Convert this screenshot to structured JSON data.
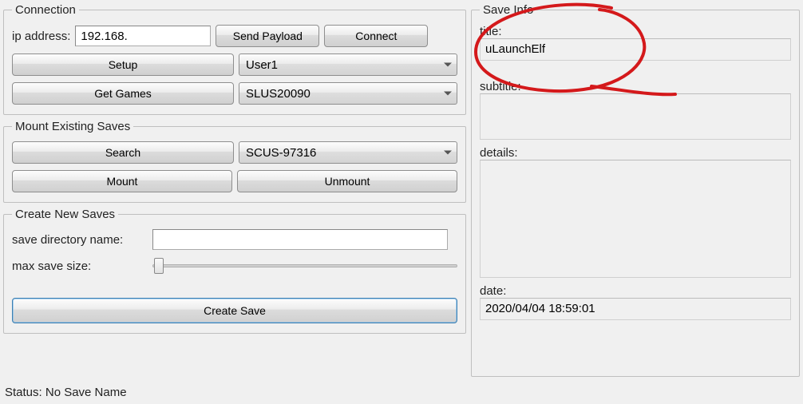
{
  "connection": {
    "legend": "Connection",
    "ip_label": "ip address:",
    "ip_value": "192.168.",
    "send_payload": "Send Payload",
    "connect": "Connect",
    "setup": "Setup",
    "user_combo": "User1",
    "get_games": "Get Games",
    "game_combo": "SLUS20090"
  },
  "mount": {
    "legend": "Mount Existing Saves",
    "search": "Search",
    "save_combo": "SCUS-97316",
    "mount_btn": "Mount",
    "unmount_btn": "Unmount"
  },
  "create": {
    "legend": "Create New Saves",
    "dir_label": "save directory name:",
    "dir_value": "",
    "size_label": "max save size:",
    "create_btn": "Create Save"
  },
  "save_info": {
    "legend": "Save Info",
    "title_label": "title:",
    "title_value": "uLaunchElf",
    "subtitle_label": "subtitle:",
    "subtitle_value": "",
    "details_label": "details:",
    "details_value": "",
    "date_label": "date:",
    "date_value": "2020/04/04 18:59:01"
  },
  "status": "Status: No Save Name"
}
